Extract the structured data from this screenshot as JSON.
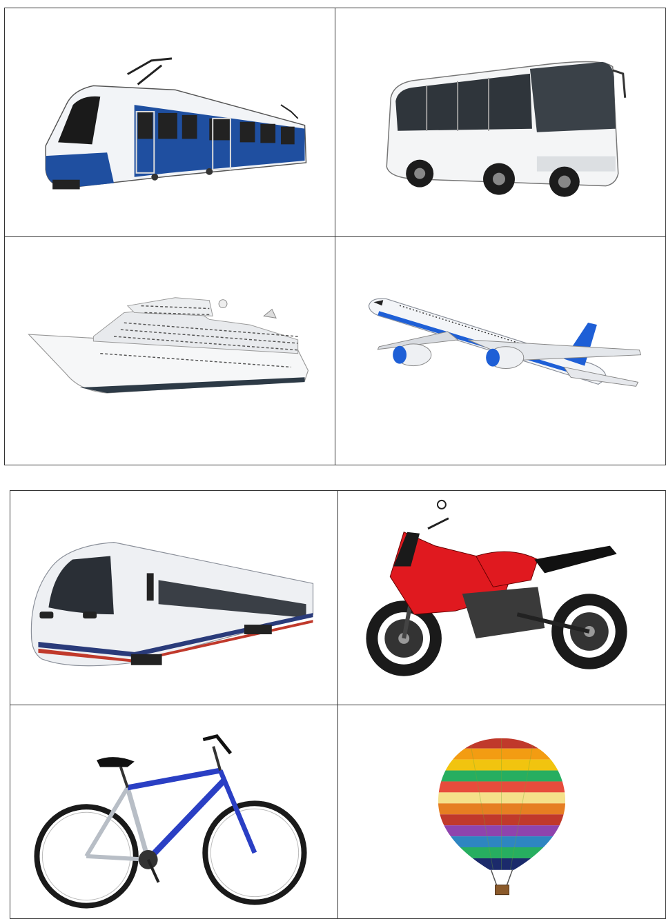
{
  "sheets": [
    {
      "cards": [
        {
          "subject": "tram",
          "icon": "tram-icon"
        },
        {
          "subject": "bus",
          "icon": "bus-icon"
        },
        {
          "subject": "cruise-ship",
          "icon": "ship-icon"
        },
        {
          "subject": "airplane",
          "icon": "airplane-icon"
        }
      ]
    },
    {
      "cards": [
        {
          "subject": "train",
          "icon": "train-icon"
        },
        {
          "subject": "motorcycle",
          "icon": "motorcycle-icon"
        },
        {
          "subject": "bicycle",
          "icon": "bicycle-icon"
        },
        {
          "subject": "hot-air-balloon",
          "icon": "hot-air-balloon-icon"
        }
      ]
    }
  ],
  "colors": {
    "border": "#333333",
    "tram_blue": "#1f4fa0",
    "bike_blue": "#2a3fc4",
    "moto_red": "#e0191f",
    "plane_blue": "#1e5fd6"
  }
}
